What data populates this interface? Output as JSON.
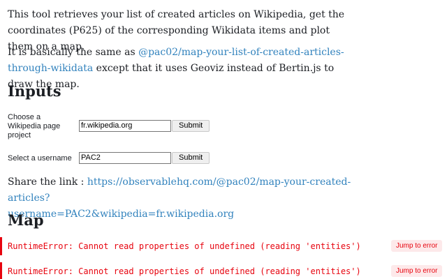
{
  "intro": {
    "p1": "This tool retrieves your list of created articles on Wikipedia, get the coordinates (P625) of the corresponding Wikidata items and plot them on a map.",
    "p2_prefix": "It is basically the same as ",
    "p2_link": "@pac02/map-your-list-of-created-articles-through-wikidata",
    "p2_suffix": " except that it uses Geoviz instead of Bertin.js to draw the map."
  },
  "inputs": {
    "heading": "Inputs",
    "project": {
      "label": "Choose a Wikipedia page project",
      "value": "fr.wikipedia.org",
      "button": "Submit"
    },
    "username": {
      "label": "Select a username",
      "value": "PAC2",
      "button": "Submit"
    }
  },
  "share": {
    "prefix": "Share the link : ",
    "link_line1": "https://observablehq.com/@pac02/map-your-created-articles?",
    "link_line2": "username=PAC2&wikipedia=fr.wikipedia.org"
  },
  "map": {
    "heading": "Map"
  },
  "errors": [
    {
      "message": "RuntimeError: Cannot read properties of undefined (reading 'entities')",
      "jump_label": "Jump to error"
    },
    {
      "message": "RuntimeError: Cannot read properties of undefined (reading 'entities')",
      "jump_label": "Jump to error"
    }
  ],
  "colors": {
    "link": "#3182bd",
    "error": "#e7040f",
    "text": "#1b1e23"
  }
}
